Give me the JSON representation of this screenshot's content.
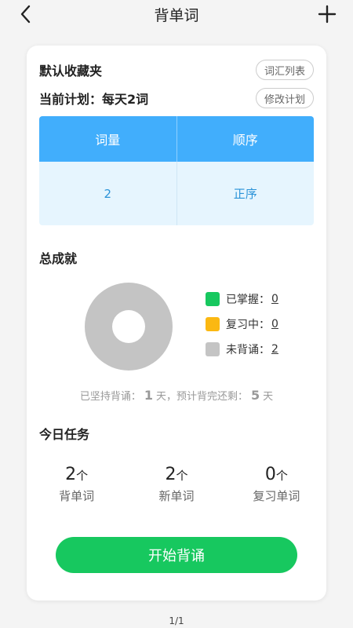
{
  "header": {
    "title": "背单词"
  },
  "card": {
    "folder_name": "默认收藏夹",
    "word_list_button": "词汇列表",
    "plan_text": "当前计划：每天2词",
    "edit_plan_button": "修改计划",
    "table": {
      "headers": [
        "词量",
        "顺序"
      ],
      "values": [
        "2",
        "正序"
      ]
    },
    "achievement_title": "总成就",
    "chart_data": {
      "type": "pie",
      "categories": [
        "已掌握",
        "复习中",
        "未背诵"
      ],
      "values": [
        0,
        0,
        2
      ],
      "colors": [
        "#17c85f",
        "#fbb812",
        "#c4c4c4"
      ]
    },
    "legend": [
      {
        "label": "已掌握：",
        "value": "0",
        "color": "#17c85f"
      },
      {
        "label": "复习中：",
        "value": "0",
        "color": "#fbb812"
      },
      {
        "label": "未背诵：",
        "value": "2",
        "color": "#c4c4c4"
      }
    ],
    "streak": {
      "prefix": "已坚持背诵：",
      "days": "1",
      "middle": "天，预计背完还剩：",
      "remaining": "5",
      "suffix": "天"
    },
    "today_title": "今日任务",
    "tasks": [
      {
        "count": "2",
        "unit": "个",
        "label": "背单词"
      },
      {
        "count": "2",
        "unit": "个",
        "label": "新单词"
      },
      {
        "count": "0",
        "unit": "个",
        "label": "复习单词"
      }
    ],
    "start_button": "开始背诵"
  },
  "pager": {
    "current": "1",
    "separator": "/",
    "total": "1"
  }
}
